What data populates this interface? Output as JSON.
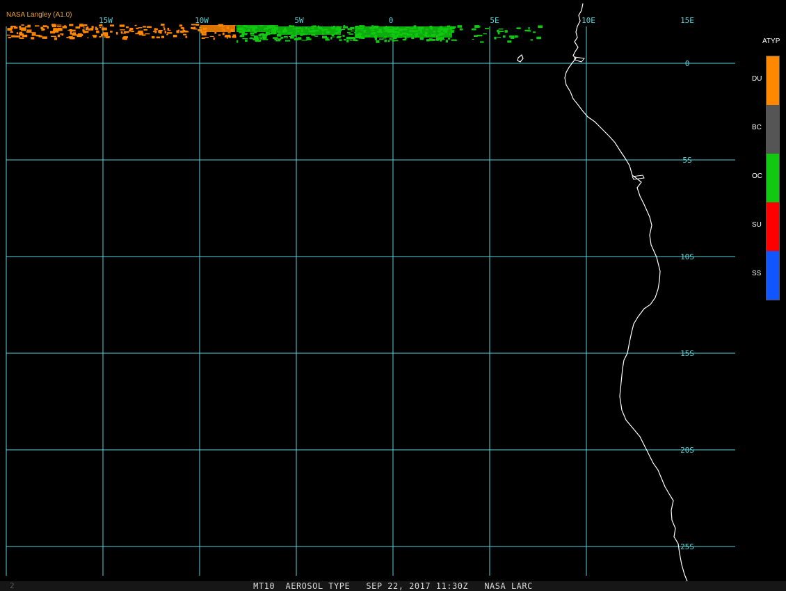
{
  "credit": "NASA Langley (A1.0)",
  "frame_number": "2",
  "caption": "MT10  AEROSOL TYPE   SEP 22, 2017 11:30Z   NASA LARC",
  "map": {
    "longitude_labels": [
      "15W",
      "10W",
      "5W",
      "0",
      "5E",
      "10E",
      "15E"
    ],
    "latitude_labels": [
      "0",
      "5S",
      "10S",
      "15S",
      "20S",
      "25S"
    ],
    "grid_color": "#59d6da",
    "coast_color": "#ffffff"
  },
  "legend": {
    "title": "ATYP",
    "items": [
      {
        "label": "DU",
        "color": "#ff8800"
      },
      {
        "label": "BC",
        "color": "#555555"
      },
      {
        "label": "OC",
        "color": "#11c911"
      },
      {
        "label": "SU",
        "color": "#ff0000"
      },
      {
        "label": "SS",
        "color": "#1155ff"
      }
    ]
  }
}
